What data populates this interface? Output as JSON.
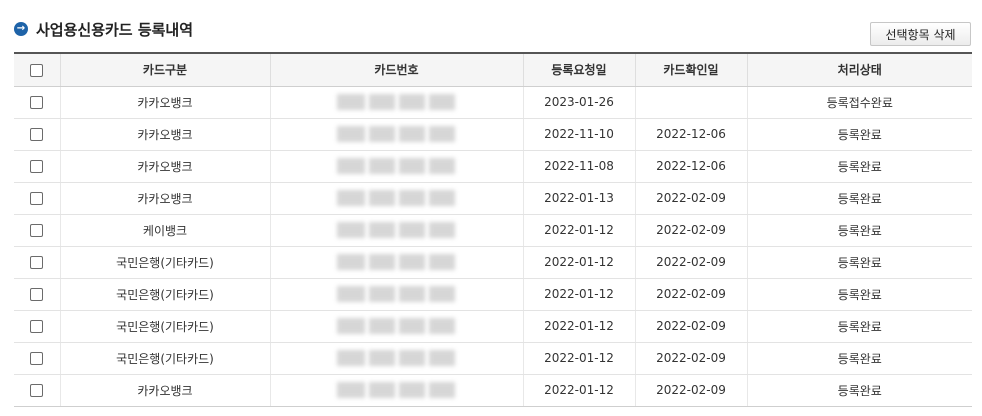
{
  "header": {
    "title": "사업용신용카드 등록내역",
    "delete_label": "선택항목 삭제"
  },
  "columns": [
    "카드구분",
    "카드번호",
    "등록요청일",
    "카드확인일",
    "처리상태"
  ],
  "rows": [
    {
      "card_type": "카카오뱅크",
      "request_date": "2023-01-26",
      "confirm_date": "",
      "status": "등록접수완료"
    },
    {
      "card_type": "카카오뱅크",
      "request_date": "2022-11-10",
      "confirm_date": "2022-12-06",
      "status": "등록완료"
    },
    {
      "card_type": "카카오뱅크",
      "request_date": "2022-11-08",
      "confirm_date": "2022-12-06",
      "status": "등록완료"
    },
    {
      "card_type": "카카오뱅크",
      "request_date": "2022-01-13",
      "confirm_date": "2022-02-09",
      "status": "등록완료"
    },
    {
      "card_type": "케이뱅크",
      "request_date": "2022-01-12",
      "confirm_date": "2022-02-09",
      "status": "등록완료"
    },
    {
      "card_type": "국민은행(기타카드)",
      "request_date": "2022-01-12",
      "confirm_date": "2022-02-09",
      "status": "등록완료"
    },
    {
      "card_type": "국민은행(기타카드)",
      "request_date": "2022-01-12",
      "confirm_date": "2022-02-09",
      "status": "등록완료"
    },
    {
      "card_type": "국민은행(기타카드)",
      "request_date": "2022-01-12",
      "confirm_date": "2022-02-09",
      "status": "등록완료"
    },
    {
      "card_type": "국민은행(기타카드)",
      "request_date": "2022-01-12",
      "confirm_date": "2022-02-09",
      "status": "등록완료"
    },
    {
      "card_type": "카카오뱅크",
      "request_date": "2022-01-12",
      "confirm_date": "2022-02-09",
      "status": "등록완료"
    }
  ],
  "icons": {
    "title": "arrow-right-circle-icon",
    "title_color": "#1e63a8"
  }
}
